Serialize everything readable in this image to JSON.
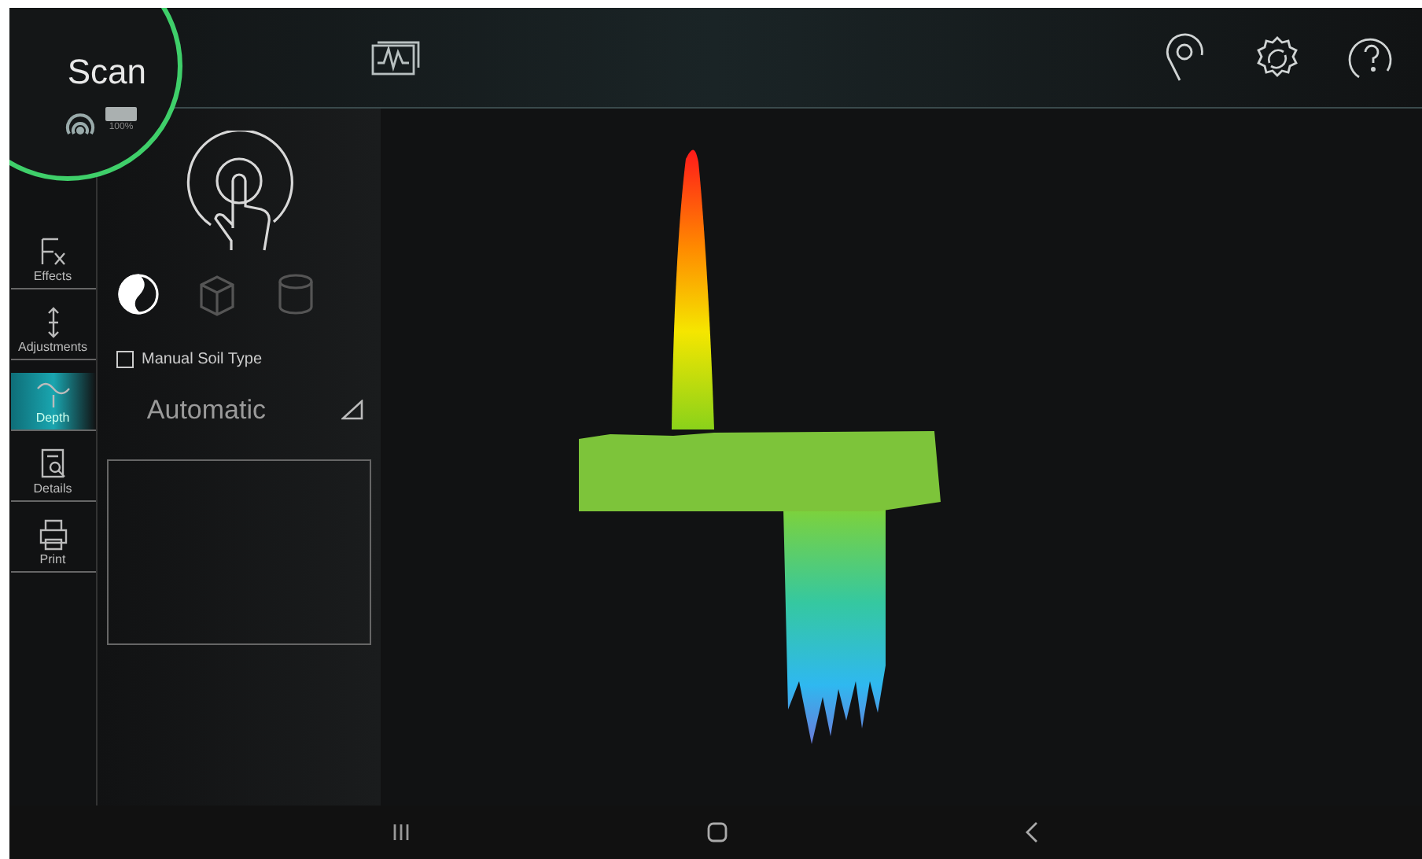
{
  "header": {
    "title": "Scan",
    "battery": "100%"
  },
  "sidebar": {
    "items": [
      {
        "label": "Effects",
        "selected": false
      },
      {
        "label": "Adjustments",
        "selected": false
      },
      {
        "label": "Depth",
        "selected": true
      },
      {
        "label": "Details",
        "selected": false
      },
      {
        "label": "Print",
        "selected": false
      }
    ]
  },
  "panel": {
    "modes": [
      {
        "selected": true
      },
      {
        "selected": false
      },
      {
        "selected": false
      }
    ],
    "manual_soil_type": {
      "label": "Manual Soil Type",
      "checked": false
    },
    "soil_select": {
      "value": "Automatic"
    }
  }
}
